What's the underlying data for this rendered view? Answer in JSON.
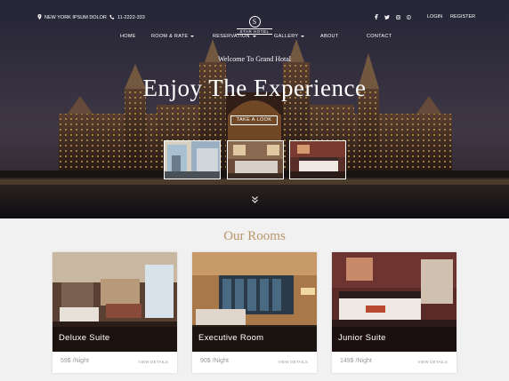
{
  "topbar": {
    "location": "NEW YORK IPSUM DOLOR",
    "phone": "11-2222-333",
    "login": "LOGIN",
    "register": "REGISTER",
    "social_icons": [
      "facebook-icon",
      "twitter-icon",
      "instagram-icon",
      "pinterest-icon"
    ]
  },
  "logo": {
    "letter": "S",
    "name": "STAR HOTEL"
  },
  "nav": {
    "home": "HOME",
    "room_rate": "ROOM & RATE",
    "reservation": "RESERVATION",
    "gallery": "GALLERY",
    "about": "ABOUT",
    "contact": "CONTACT"
  },
  "hero": {
    "welcome": "Welcome To Grand Hotal",
    "headline": "Enjoy The Experience",
    "cta": "TAKE A LOOK"
  },
  "rooms": {
    "title": "Our Rooms",
    "items": [
      {
        "name": "Deluxe Suite",
        "price": "59$ /Night",
        "details": "VIEW DETAILS"
      },
      {
        "name": "Executive Room",
        "price": "90$ /Night",
        "details": "VIEW DETAILS"
      },
      {
        "name": "Junior Suite",
        "price": "149$ /Night",
        "details": "VIEW DETAILS"
      }
    ]
  },
  "colors": {
    "accent": "#b8956a",
    "hero_dark": "#1d1c24",
    "page_bg": "#f1f1f1"
  }
}
